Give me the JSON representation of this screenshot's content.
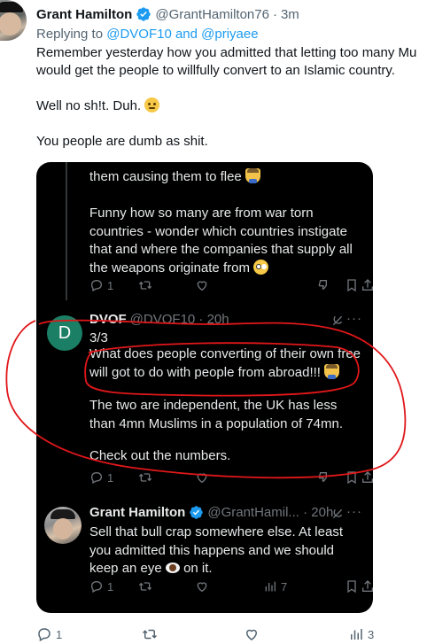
{
  "author": {
    "name": "Grant Hamilton",
    "handle": "@GrantHamilton76",
    "separator": "·",
    "time": "3m"
  },
  "replying": {
    "prefix": "Replying to ",
    "targets": "@DVOF10 and @priyaee"
  },
  "body": {
    "line1": "Remember yesterday how you admitted that letting too many Mu",
    "line2": "would get the people to willfully convert to an Islamic country.",
    "line3": "Well no sh!t. Duh.",
    "line4": "You people are dumb as shit."
  },
  "screenshot": {
    "prev_tweet": {
      "line1": "them causing them to flee",
      "line2": "Funny how so many are from war torn",
      "line3": "countries - wonder which countries instigate",
      "line4": "that and where the companies that supply all",
      "line5": "the weapons originate from",
      "reply_count": "1"
    },
    "dvof": {
      "avatar_letter": "D",
      "name": "DVOF",
      "handle": "@DVOF10 · 20h",
      "more": "···",
      "line1": "3/3",
      "line2": "What does people converting of their own free",
      "line3": "will got to do with people from abroad!!!",
      "line4": "The two are independent, the UK has less",
      "line5": "than 4mn Muslims in a population of 74mn.",
      "line6": "Check out the numbers.",
      "reply_count": "1"
    },
    "grant_reply": {
      "name": "Grant Hamilton",
      "handle": "@GrantHamil... · 20h",
      "more": "···",
      "line1": "Sell that bull crap somewhere else. At least",
      "line2": "you admitted this happens and we should",
      "line3a": "keep an eye",
      "line3b": "on it.",
      "reply_count": "1",
      "views": "7"
    }
  },
  "actions": {
    "replies": "1",
    "views": "3"
  },
  "colors": {
    "annotation": "#e0171a",
    "link": "#1d9bf0",
    "verified": "#1d9bf0",
    "dvof_avatar": "#1a7f64"
  }
}
